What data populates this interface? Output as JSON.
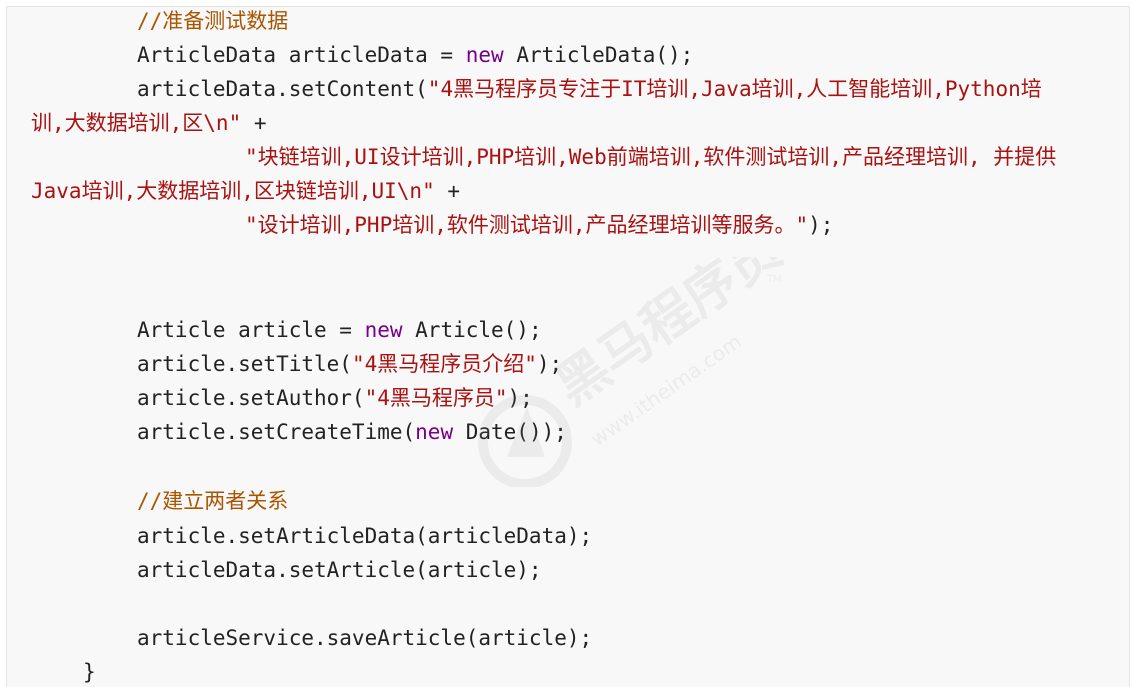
{
  "code": {
    "comment_prepare": "//准备测试数据",
    "l2": {
      "a": "ArticleData articleData = ",
      "kw": "new",
      "b": " ArticleData();"
    },
    "l3": {
      "a": "articleData.setContent(",
      "str": "\"4黑马程序员专注于IT培训,Java培训,人工智能培训,Python培"
    },
    "l4": {
      "str": "训,大数据培训,区\\n\"",
      "b": " +"
    },
    "l5": {
      "str": "\"块链培训,UI设计培训,PHP培训,Web前端培训,软件测试培训,产品经理培训, 并提供"
    },
    "l6": {
      "str": "Java培训,大数据培训,区块链培训,UI\\n\"",
      "b": " +"
    },
    "l7": {
      "str": "\"设计培训,PHP培训,软件测试培训,产品经理培训等服务。\"",
      "b": ");"
    },
    "l8": {
      "a": "Article article = ",
      "kw": "new",
      "b": " Article();"
    },
    "l9": {
      "a": "article.setTitle(",
      "str": "\"4黑马程序员介绍\"",
      "b": ");"
    },
    "l10": {
      "a": "article.setAuthor(",
      "str": "\"4黑马程序员\"",
      "b": ");"
    },
    "l11": {
      "a": "article.setCreateTime(",
      "kw": "new",
      "b": " Date());"
    },
    "comment_relation": "//建立两者关系",
    "l13": "article.setArticleData(articleData);",
    "l14": "articleData.setArticle(article);",
    "l15": "articleService.saveArticle(article);",
    "l16": "}"
  },
  "watermark": {
    "brand": "黑马程序员",
    "url": "www.itheima.com",
    "tm": "TM"
  }
}
